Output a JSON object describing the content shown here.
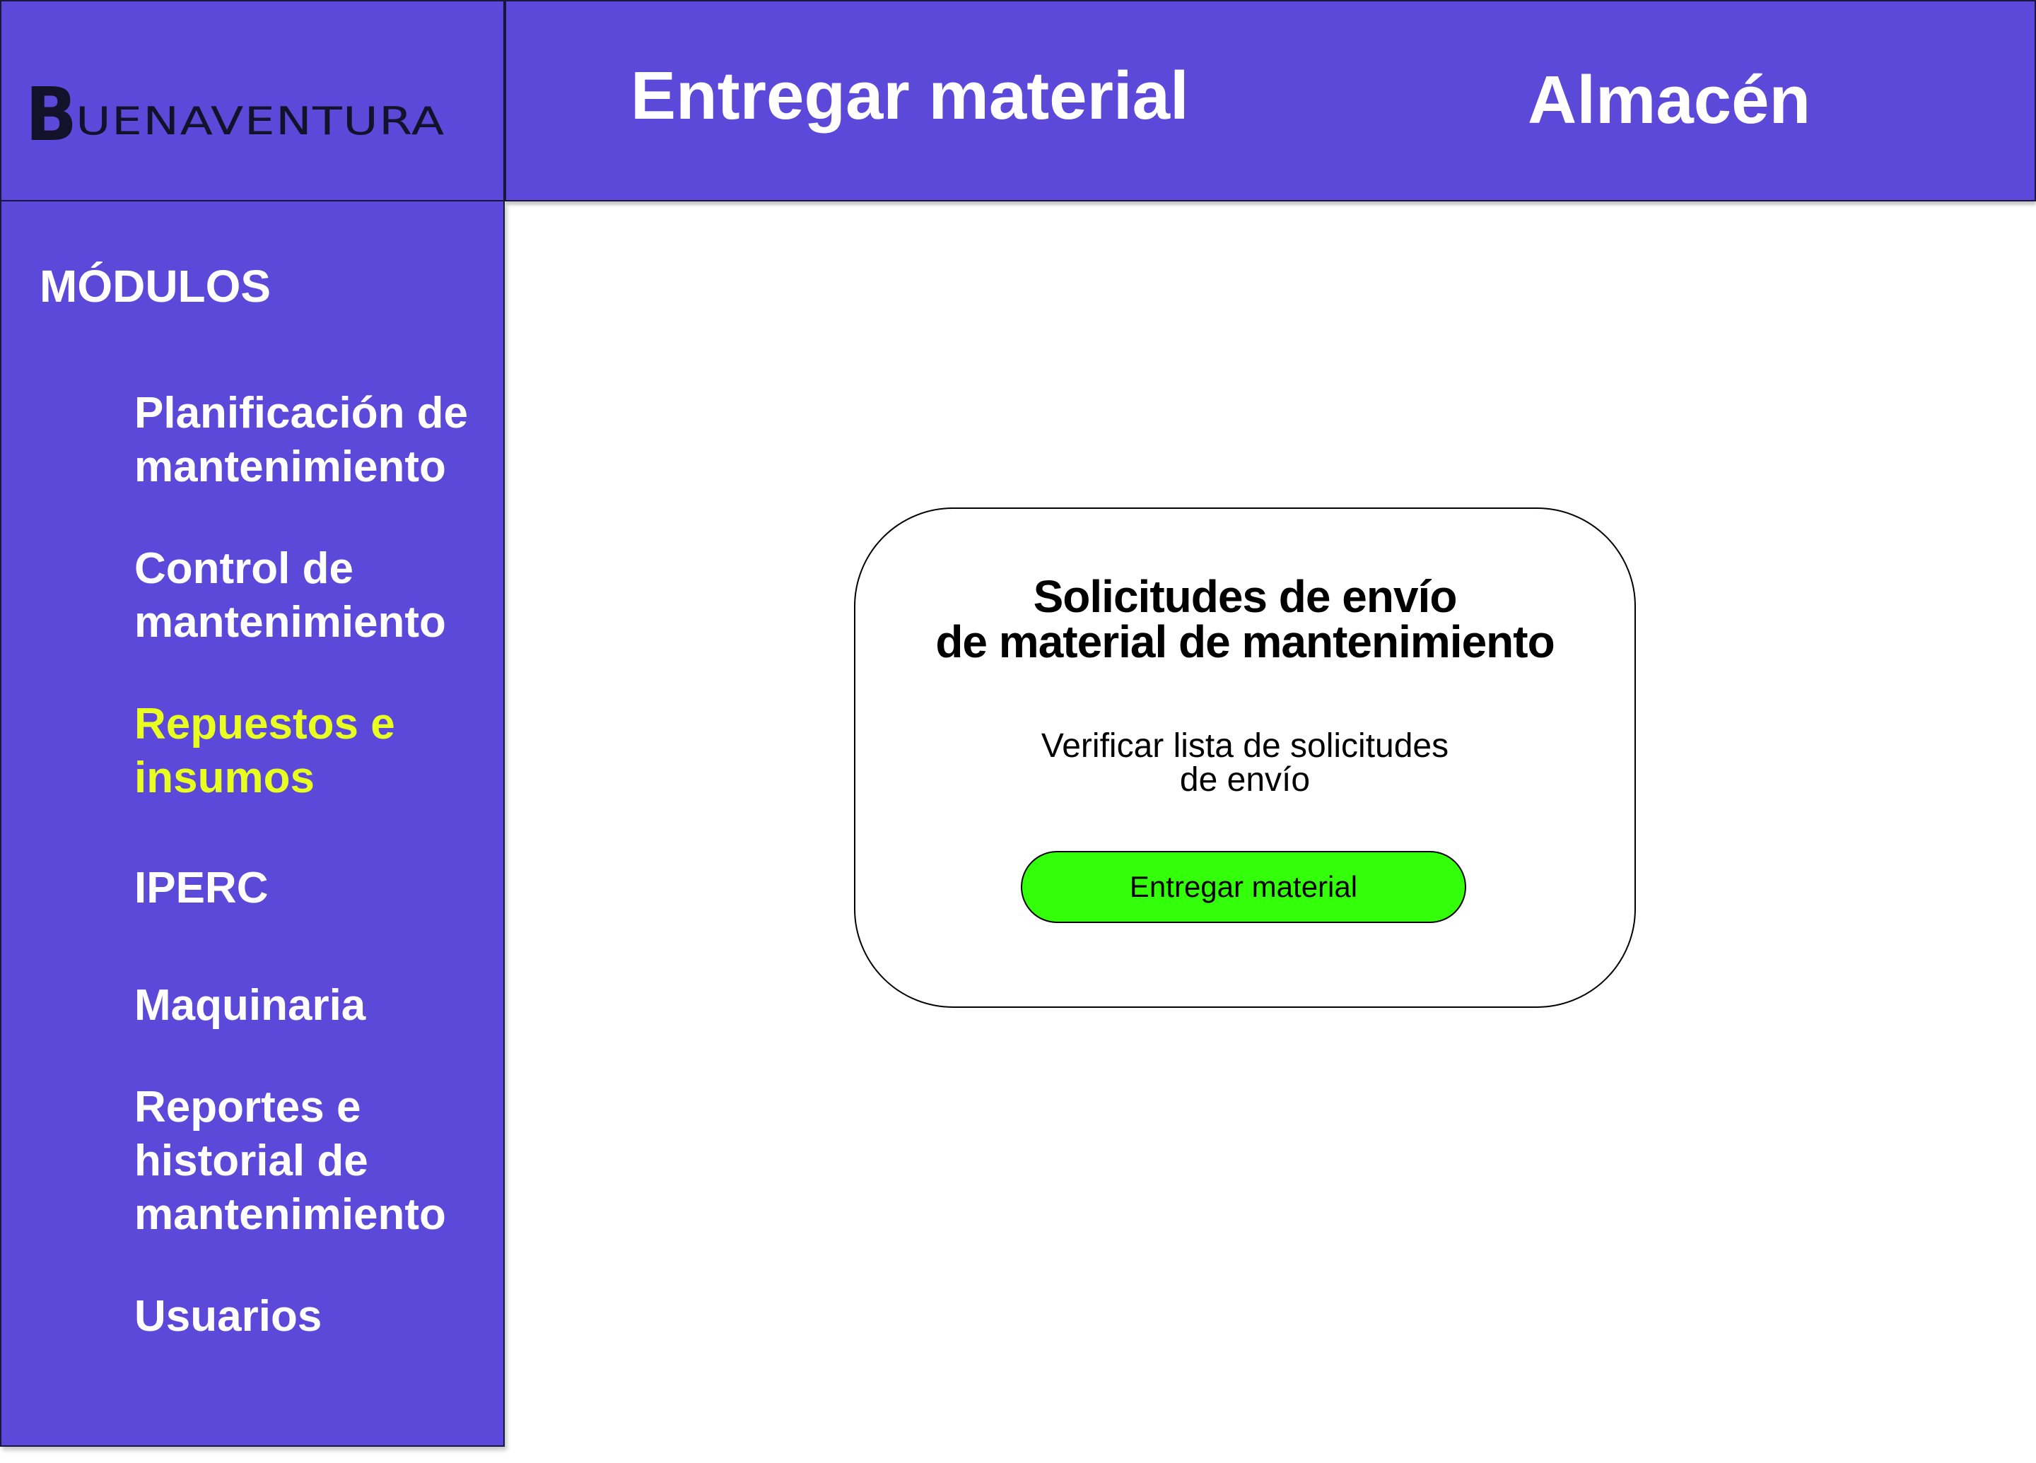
{
  "brand": {
    "logo_initial": "B",
    "logo_rest": "UENAVENTURA"
  },
  "header": {
    "page_title": "Entregar material",
    "section_title": "Almacén"
  },
  "sidebar": {
    "heading": "MÓDULOS",
    "items": [
      {
        "label": "Planificación de mantenimiento",
        "active": false
      },
      {
        "label": "Control de mantenimiento",
        "active": false
      },
      {
        "label": "Repuestos e insumos",
        "active": true
      },
      {
        "label": "IPERC",
        "active": false
      },
      {
        "label": "Maquinaria",
        "active": false
      },
      {
        "label": "Reportes e historial de mantenimiento",
        "active": false
      },
      {
        "label": "Usuarios",
        "active": false
      }
    ]
  },
  "card": {
    "title_line1": "Solicitudes de envío",
    "title_line2": "de material de mantenimiento",
    "subtitle_line1": "Verificar lista de solicitudes",
    "subtitle_line2": "de envío",
    "button_label": "Entregar material"
  },
  "colors": {
    "primary": "#5c49d9",
    "active_nav": "#e8ff1f",
    "button": "#33ff0b"
  }
}
